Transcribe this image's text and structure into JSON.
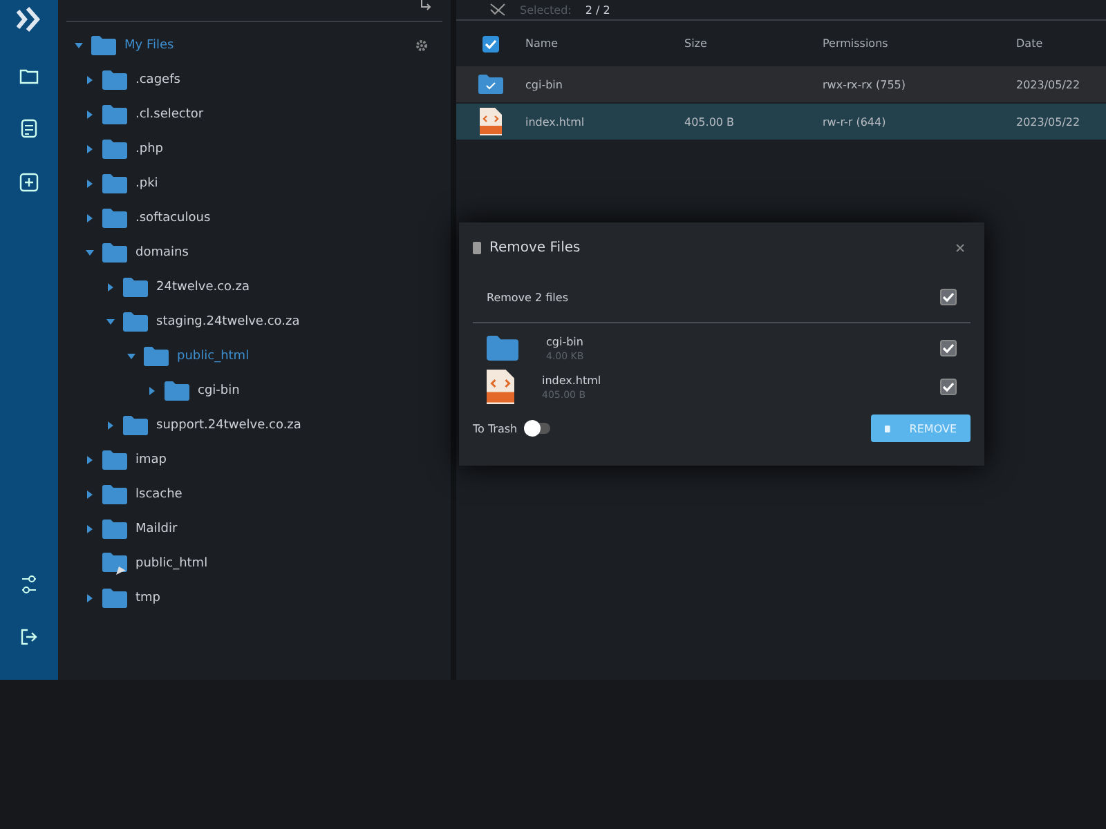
{
  "tree": {
    "root": {
      "label": "My Files",
      "expanded": true
    },
    "items": [
      {
        "label": ".cagefs",
        "expanded": false,
        "selected": false
      },
      {
        "label": ".cl.selector",
        "expanded": false,
        "selected": false
      },
      {
        "label": ".php",
        "expanded": false,
        "selected": false
      },
      {
        "label": ".pki",
        "expanded": false,
        "selected": false
      },
      {
        "label": ".softaculous",
        "expanded": false,
        "selected": false
      },
      {
        "label": "domains",
        "expanded": true,
        "selected": false,
        "children": [
          {
            "label": "24twelve.co.za",
            "expanded": false,
            "selected": false
          },
          {
            "label": "staging.24twelve.co.za",
            "expanded": true,
            "selected": false,
            "children": [
              {
                "label": "public_html",
                "expanded": true,
                "selected": true,
                "children": [
                  {
                    "label": "cgi-bin",
                    "expanded": false,
                    "selected": false
                  }
                ]
              }
            ]
          },
          {
            "label": "support.24twelve.co.za",
            "expanded": false,
            "selected": false
          }
        ]
      },
      {
        "label": "imap",
        "expanded": false,
        "selected": false
      },
      {
        "label": "lscache",
        "expanded": false,
        "selected": false
      },
      {
        "label": "Maildir",
        "expanded": false,
        "selected": false
      },
      {
        "label": "public_html",
        "kind": "link",
        "selected": false
      },
      {
        "label": "tmp",
        "expanded": false,
        "selected": false
      }
    ]
  },
  "toolbar": {
    "selected_label": "Selected:",
    "selected_count": "2 / 2"
  },
  "table": {
    "all_checked": true,
    "columns": [
      "Name",
      "Size",
      "Permissions",
      "Date"
    ],
    "rows": [
      {
        "kind": "folder",
        "name": "cgi-bin",
        "size": "",
        "permissions": "rwx-rx-rx (755)",
        "date": "2023/05/22",
        "selected": true,
        "hover": false
      },
      {
        "kind": "html",
        "name": "index.html",
        "size": "405.00 B",
        "permissions": "rw-r-r (644)",
        "date": "2023/05/22",
        "selected": true,
        "hover": true
      }
    ]
  },
  "dialog": {
    "title": "Remove Files",
    "summary": "Remove 2 files",
    "all_checked": true,
    "files": [
      {
        "kind": "folder",
        "name": "cgi-bin",
        "size": "4.00 KB",
        "checked": true
      },
      {
        "kind": "html",
        "name": "index.html",
        "size": "405.00 B",
        "checked": true
      }
    ],
    "trash_label": "To Trash",
    "to_trash": false,
    "button": "REMOVE"
  }
}
